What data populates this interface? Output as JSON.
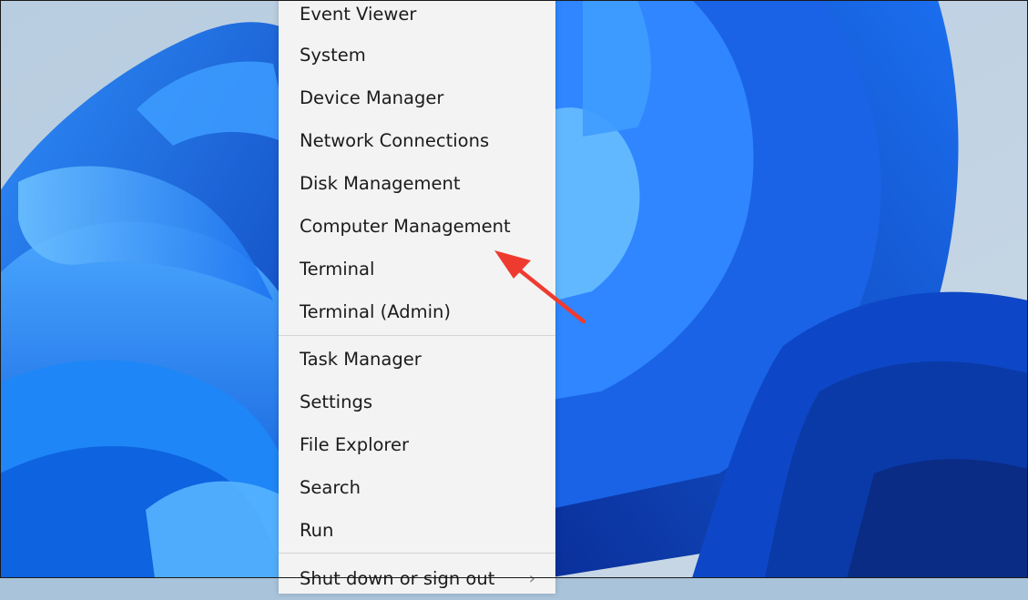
{
  "menu": {
    "items": [
      {
        "label": "Event Viewer"
      },
      {
        "label": "System"
      },
      {
        "label": "Device Manager"
      },
      {
        "label": "Network Connections"
      },
      {
        "label": "Disk Management"
      },
      {
        "label": "Computer Management"
      },
      {
        "label": "Terminal"
      },
      {
        "label": "Terminal (Admin)"
      },
      {
        "label": "Task Manager"
      },
      {
        "label": "Settings"
      },
      {
        "label": "File Explorer"
      },
      {
        "label": "Search"
      },
      {
        "label": "Run"
      },
      {
        "label": "Shut down or sign out"
      }
    ],
    "submenu_icon": "chevron-right-icon"
  },
  "colors": {
    "menu_background": "#f3f3f3",
    "menu_text": "#1b1b1b",
    "annotation_arrow": "#ef3b2f",
    "wallpaper_blue": "#1466e6"
  }
}
